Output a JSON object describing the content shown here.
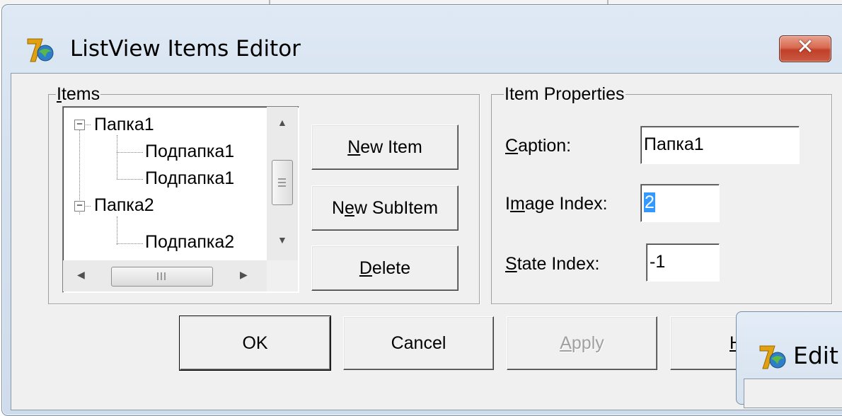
{
  "dialog": {
    "title": "ListView Items Editor",
    "close_symbol": "✕",
    "icon": "delphi-app-icon"
  },
  "items_group": {
    "legend_underlined": "I",
    "legend_rest": "tems",
    "tree": [
      {
        "label": "Папка1",
        "expander": "−",
        "level": 0
      },
      {
        "label": "Подпапка1",
        "level": 1
      },
      {
        "label": "Подпапка1",
        "level": 1
      },
      {
        "label": "Папка2",
        "expander": "−",
        "level": 0
      },
      {
        "label": "Подпапка2",
        "level": 1
      }
    ]
  },
  "buttons": {
    "new_item": {
      "underlined": "N",
      "rest": "ew Item"
    },
    "new_subitem": {
      "before": "N",
      "underlined": "e",
      "rest": "w SubItem"
    },
    "delete": {
      "underlined": "D",
      "rest": "elete"
    }
  },
  "properties_group": {
    "legend": "Item Properties",
    "caption": {
      "underlined": "C",
      "rest": "aption:",
      "value": "Папка1"
    },
    "image_index": {
      "before": "I",
      "underlined": "m",
      "rest": "age Index:",
      "value": "2"
    },
    "state_index": {
      "underlined": "S",
      "rest": "tate Index:",
      "value": "-1"
    }
  },
  "footer": {
    "ok": "OK",
    "cancel": "Cancel",
    "apply": {
      "underlined": "A",
      "rest": "pply"
    },
    "help_partial": "H"
  },
  "background_window": {
    "title_partial": "Edit"
  },
  "colors": {
    "selection": "#3399ff",
    "close_button": "#c1402a",
    "dialog_face": "#f0f0f0"
  }
}
